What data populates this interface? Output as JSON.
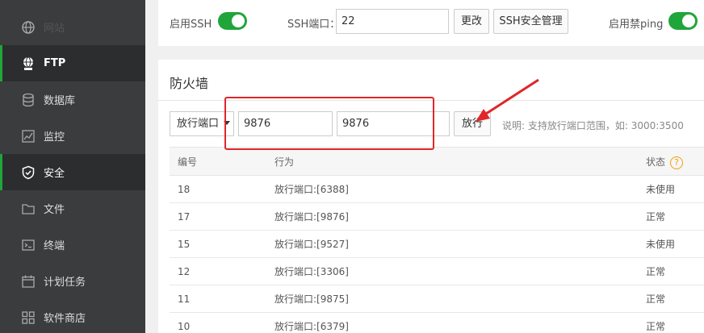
{
  "sidebar": {
    "items": [
      {
        "label": "网站",
        "icon": "globe-icon"
      },
      {
        "label": "FTP",
        "icon": "ftp-globe-icon"
      },
      {
        "label": "数据库",
        "icon": "database-icon"
      },
      {
        "label": "监控",
        "icon": "monitor-chart-icon"
      },
      {
        "label": "安全",
        "icon": "shield-icon"
      },
      {
        "label": "文件",
        "icon": "folder-icon"
      },
      {
        "label": "终端",
        "icon": "terminal-icon"
      },
      {
        "label": "计划任务",
        "icon": "calendar-icon"
      },
      {
        "label": "软件商店",
        "icon": "grid-icon"
      }
    ]
  },
  "ssh": {
    "enable_label": "启用SSH",
    "port_label": "SSH端口：",
    "port_value": "22",
    "change_button": "更改",
    "manage_button": "SSH安全管理",
    "ping_label": "启用禁ping"
  },
  "firewall": {
    "title": "防火墙",
    "select_value": "放行端口",
    "port_from": "9876",
    "port_to": "9876",
    "allow_button": "放行",
    "note": "说明: 支持放行端口范围，如: 3000:3500",
    "columns": {
      "id": "编号",
      "action": "行为",
      "status": "状态",
      "help": "?"
    },
    "rows": [
      {
        "id": "18",
        "action": "放行端口:[6388]",
        "status": "未使用"
      },
      {
        "id": "17",
        "action": "放行端口:[9876]",
        "status": "正常"
      },
      {
        "id": "15",
        "action": "放行端口:[9527]",
        "status": "未使用"
      },
      {
        "id": "12",
        "action": "放行端口:[3306]",
        "status": "正常"
      },
      {
        "id": "11",
        "action": "放行端口:[9875]",
        "status": "正常"
      },
      {
        "id": "10",
        "action": "放行端口:[6379]",
        "status": "正常"
      }
    ]
  },
  "colors": {
    "accent": "#20a53a",
    "highlight": "#e0262a",
    "sidebar_bg": "#3a3c3e"
  }
}
